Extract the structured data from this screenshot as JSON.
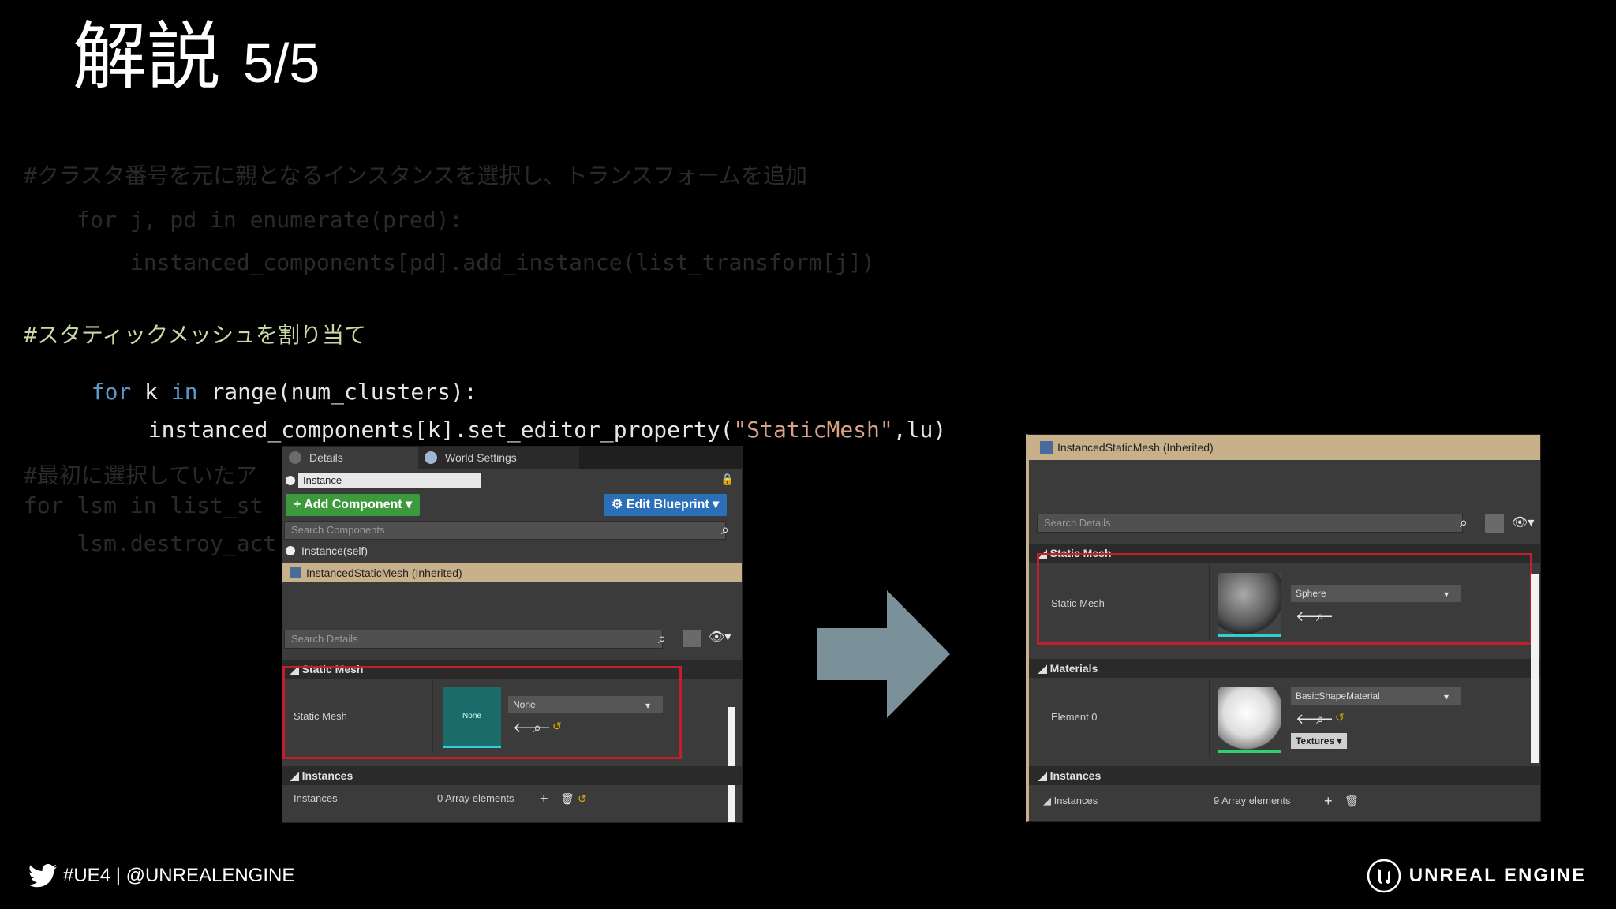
{
  "title": {
    "jp": "解説",
    "page": "5/5"
  },
  "code": {
    "faded_lines": [
      "#クラスタ番号を元に親となるインスタンスを選択し、トランスフォームを追加",
      "    for j, pd in enumerate(pred):",
      "        instanced_components[pd].add_instance(list_transform[j])"
    ],
    "comment2": "#スタティックメッシュを割り当て",
    "for_kw": "for",
    "for_var": " k ",
    "in_kw": "in",
    "range_text": " range(num_clusters):",
    "call_prefix": "instanced_components[k].set_editor_property(",
    "call_string": "\"StaticMesh\"",
    "call_suffix": ",lu)",
    "faded_bottom": [
      "#最初に選択していたア",
      "for lsm in list_st",
      "    lsm.destroy_act"
    ]
  },
  "left_panel": {
    "tab_details": "Details",
    "tab_world": "World Settings",
    "instance_field": "Instance",
    "add_component": "+ Add Component ▾",
    "edit_blueprint": "⚙ Edit Blueprint ▾",
    "search_components": "Search Components",
    "instance_self": "Instance(self)",
    "ism_inherited": "InstancedStaticMesh (Inherited)",
    "search_details": "Search Details",
    "static_mesh_header": "◢ Static Mesh",
    "static_mesh_label": "Static Mesh",
    "thumb_label": "None",
    "mesh_dropdown": "None",
    "instances_header": "◢ Instances",
    "instances_label": "Instances",
    "instances_value": "0 Array elements"
  },
  "right_panel": {
    "ism_inherited": "InstancedStaticMesh (Inherited)",
    "search_details": "Search Details",
    "static_mesh_header": "◢ Static Mesh",
    "static_mesh_label": "Static Mesh",
    "mesh_dropdown": "Sphere",
    "materials_header": "◢ Materials",
    "element_label": "Element 0",
    "material_dropdown": "BasicShapeMaterial",
    "textures_button": "Textures ▾",
    "instances_header": "◢ Instances",
    "instances_label": "◢ Instances",
    "instances_value": "9 Array elements"
  },
  "footer": {
    "left_text": "#UE4 | @UNREALENGINE",
    "right_text": "UNREAL ENGINE"
  },
  "colors": {
    "background": "#000000",
    "comment": "#c9d9a6",
    "keyword": "#5d97c9",
    "string": "#d6a285",
    "arrow": "#7b919a",
    "highlight_red": "#c21f2c",
    "add_component_green": "#3c9a3c",
    "edit_blueprint_blue": "#2b6fb8"
  }
}
